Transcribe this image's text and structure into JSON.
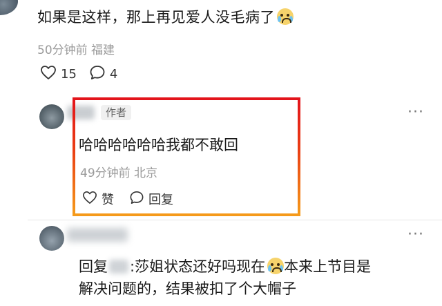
{
  "comment1": {
    "text": "如果是这样，那上再见爱人没毛病了",
    "emoji": "crying-laugh-emoji",
    "time": "50分钟前",
    "location": "福建",
    "likes": "15",
    "replies": "4"
  },
  "comment2": {
    "author_tag": "作者",
    "text": "哈哈哈哈哈哈我都不敢回",
    "time": "49分钟前",
    "location": "北京",
    "like_label": "赞",
    "reply_label": "回复",
    "highlight_colors": [
      "#e3141b",
      "#f59a1a"
    ]
  },
  "comment3": {
    "reply_prefix": "回复",
    "colon": ":",
    "text_a": "莎姐状态还好吗现在",
    "emoji": "crying-laugh-emoji",
    "text_b": "本来上节目是",
    "line2": "解决问题的，结果被扣了个大帽子"
  },
  "more_label": "···"
}
